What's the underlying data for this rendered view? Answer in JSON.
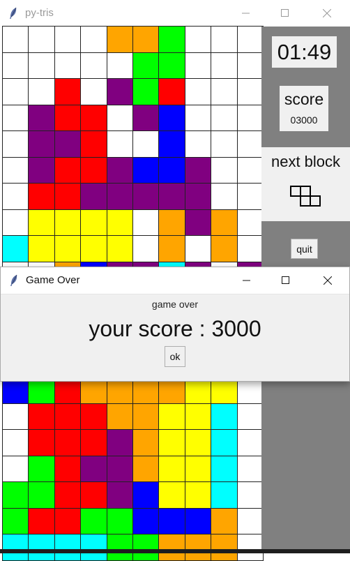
{
  "colors": {
    "W": "#ffffff",
    "O": "#ffa500",
    "G": "#00ff00",
    "R": "#ff0000",
    "P": "#800080",
    "B": "#0000ff",
    "Y": "#ffff00",
    "C": "#00ffff"
  },
  "main_window": {
    "title": "py-tris",
    "icon": "feather-icon",
    "controls": [
      "minimize-icon",
      "maximize-icon",
      "close-icon"
    ]
  },
  "board_top_rows": [
    "WWWWOOGWWW",
    "WWWWWGGWWW",
    "WWRWPGRWWW",
    "WPRRWPBWWW",
    "WPPRWWBWWW",
    "WPRRPBBPWW",
    "WRRPPPPPWW",
    "WYYYYWOPOW",
    "CYYYYWOWOW",
    "WWOBPPCPWP"
  ],
  "board_bottom_rows": [
    "BGROOOOYYW",
    "WRRROOYYCW",
    "WRRRPOYYCW",
    "WGRPPOYYCW",
    "GGRRPBYYCW",
    "GRRGGBBBOW",
    "CCCCGGOOOW"
  ],
  "sidebar": {
    "timer": "01:49",
    "score_label": "score",
    "score_value": "03000",
    "next_label": "next block",
    "next_icon": "next-block-preview-icon",
    "quit_label": "quit"
  },
  "dialog": {
    "title": "Game Over",
    "message": "game over",
    "score_text": "your score : 3000",
    "ok_label": "ok",
    "controls": [
      "minimize-icon",
      "maximize-icon",
      "close-icon"
    ]
  }
}
